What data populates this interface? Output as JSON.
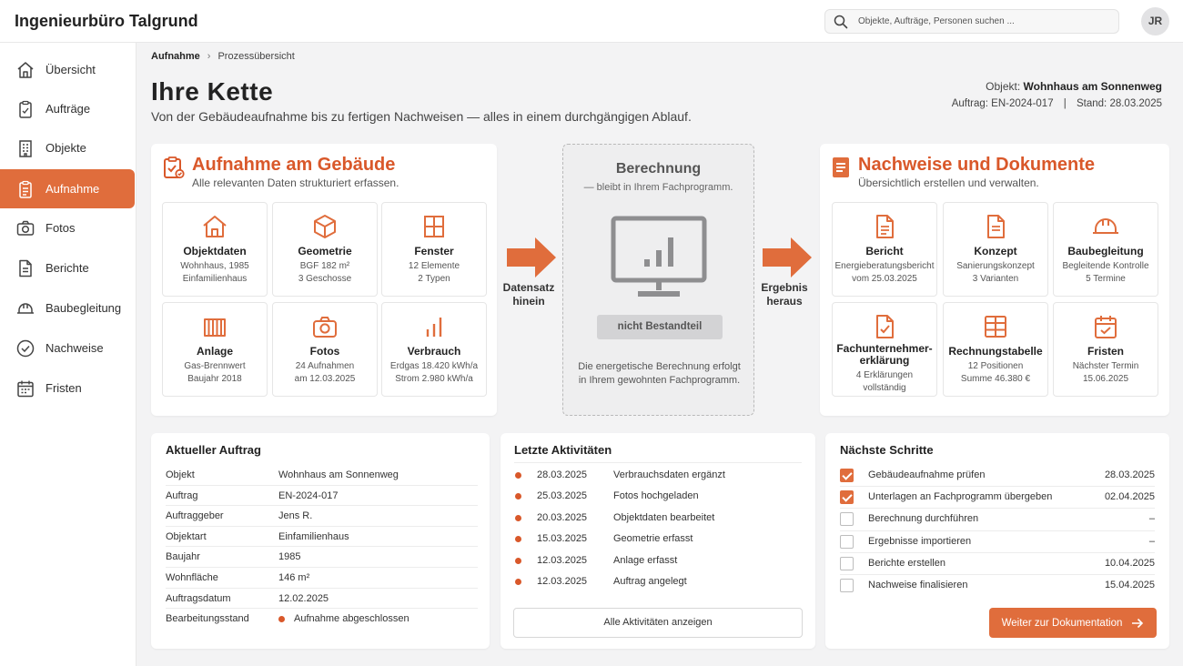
{
  "app": {
    "title": "Ingenieurbüro Talgrund"
  },
  "search": {
    "placeholder": "Objekte, Aufträge, Personen suchen ..."
  },
  "user": {
    "initials": "JR"
  },
  "sidebar": {
    "items": [
      {
        "label": "Übersicht",
        "icon": "home-icon"
      },
      {
        "label": "Aufträge",
        "icon": "clipboard-icon"
      },
      {
        "label": "Objekte",
        "icon": "building-icon"
      },
      {
        "label": "Aufnahme",
        "icon": "clipboard-list-icon",
        "active": true
      },
      {
        "label": "Fotos",
        "icon": "camera-icon"
      },
      {
        "label": "Berichte",
        "icon": "document-icon"
      },
      {
        "label": "Baubegleitung",
        "icon": "hardhat-icon"
      },
      {
        "label": "Nachweise",
        "icon": "check-circle-icon"
      },
      {
        "label": "Fristen",
        "icon": "calendar-icon"
      }
    ]
  },
  "breadcrumb": {
    "root": "Aufnahme",
    "current": "Prozessübersicht"
  },
  "page": {
    "title": "Ihre Kette",
    "subtitle": "Von der Gebäudeaufnahme bis zu fertigen Nachweisen — alles in einem durchgängigen Ablauf.",
    "object_label": "Objekt:",
    "object_value": "Wohnhaus am Sonnenweg",
    "order_line": "Auftrag: EN-2024-017",
    "separator": "|",
    "stand_line": "Stand: 28.03.2025"
  },
  "survey": {
    "title": "Aufnahme am Gebäude",
    "subtitle": "Alle relevanten Daten strukturiert erfassen.",
    "tiles": [
      {
        "title": "Objektdaten",
        "lines": [
          "Wohnhaus, 1985",
          "Einfamilienhaus"
        ],
        "icon": "house-icon"
      },
      {
        "title": "Geometrie",
        "lines": [
          "BGF 182 m²",
          "3 Geschosse"
        ],
        "icon": "cube-icon"
      },
      {
        "title": "Fenster",
        "lines": [
          "12 Elemente",
          "2 Typen"
        ],
        "icon": "window-icon"
      },
      {
        "title": "Anlage",
        "lines": [
          "Gas-Brennwert",
          "Baujahr 2018"
        ],
        "icon": "radiator-icon"
      },
      {
        "title": "Fotos",
        "lines": [
          "24 Aufnahmen",
          "am 12.03.2025"
        ],
        "icon": "camera-icon"
      },
      {
        "title": "Verbrauch",
        "lines": [
          "Erdgas 18.420 kWh/a",
          "Strom 2.980 kWh/a"
        ],
        "icon": "bar-chart-icon"
      }
    ]
  },
  "flow": {
    "in_label": [
      "Datensatz",
      "hinein"
    ],
    "out_label": [
      "Ergebnis",
      "heraus"
    ]
  },
  "calc": {
    "title": "Berechnung",
    "subtitle": "— bleibt in Ihrem Fachprogramm.",
    "badge": "nicht Bestandteil",
    "description": [
      "Die energetische Berechnung erfolgt",
      "in Ihrem gewohnten Fachprogramm."
    ]
  },
  "docs": {
    "title": "Nachweise und Dokumente",
    "subtitle": "Übersichtlich erstellen und verwalten.",
    "tiles": [
      {
        "title": "Bericht",
        "lines": [
          "Energieberatungsbericht",
          "vom 25.03.2025"
        ],
        "icon": "document-icon"
      },
      {
        "title": "Konzept",
        "lines": [
          "Sanierungskonzept",
          "3 Varianten"
        ],
        "icon": "document-lines-icon"
      },
      {
        "title": "Baubegleitung",
        "lines": [
          "Begleitende Kontrolle",
          "5 Termine"
        ],
        "icon": "hardhat-icon"
      },
      {
        "title": "Fachunternehmer-\nerklärung",
        "lines": [
          "4 Erklärungen",
          "vollständig"
        ],
        "icon": "document-check-icon"
      },
      {
        "title": "Rechnungstabelle",
        "lines": [
          "12 Positionen",
          "Summe 46.380 €"
        ],
        "icon": "table-icon"
      },
      {
        "title": "Fristen",
        "lines": [
          "Nächster Termin",
          "15.06.2025"
        ],
        "icon": "calendar-check-icon"
      }
    ]
  },
  "order": {
    "title": "Aktueller Auftrag",
    "rows": [
      {
        "key": "Objekt",
        "value": "Wohnhaus am Sonnenweg"
      },
      {
        "key": "Auftrag",
        "value": "EN-2024-017"
      },
      {
        "key": "Auftraggeber",
        "value": "Jens R."
      },
      {
        "key": "Objektart",
        "value": "Einfamilienhaus"
      },
      {
        "key": "Baujahr",
        "value": "1985"
      },
      {
        "key": "Wohnfläche",
        "value": "146 m²"
      },
      {
        "key": "Auftragsdatum",
        "value": "12.02.2025"
      },
      {
        "key": "Bearbeitungsstand",
        "value": "Aufnahme abgeschlossen",
        "status": true
      }
    ]
  },
  "activities": {
    "title": "Letzte Aktivitäten",
    "items": [
      {
        "date": "28.03.2025",
        "text": "Verbrauchsdaten ergänzt"
      },
      {
        "date": "25.03.2025",
        "text": "Fotos hochgeladen"
      },
      {
        "date": "20.03.2025",
        "text": "Objektdaten bearbeitet"
      },
      {
        "date": "15.03.2025",
        "text": "Geometrie erfasst"
      },
      {
        "date": "12.03.2025",
        "text": "Anlage erfasst"
      },
      {
        "date": "12.03.2025",
        "text": "Auftrag angelegt"
      }
    ],
    "button": "Alle Aktivitäten anzeigen"
  },
  "steps": {
    "title": "Nächste Schritte",
    "items": [
      {
        "label": "Gebäudeaufnahme prüfen",
        "date": "28.03.2025",
        "done": true
      },
      {
        "label": "Unterlagen an Fachprogramm übergeben",
        "date": "02.04.2025",
        "done": true
      },
      {
        "label": "Berechnung durchführen",
        "date": "–",
        "done": false
      },
      {
        "label": "Ergebnisse importieren",
        "date": "–",
        "done": false
      },
      {
        "label": "Berichte erstellen",
        "date": "10.04.2025",
        "done": false
      },
      {
        "label": "Nachweise finalisieren",
        "date": "15.04.2025",
        "done": false
      }
    ],
    "button": "Weiter zur Dokumentation"
  },
  "colors": {
    "accent": "#e06d3c",
    "accent_dark": "#d9582a",
    "background": "#f3f3f4"
  }
}
